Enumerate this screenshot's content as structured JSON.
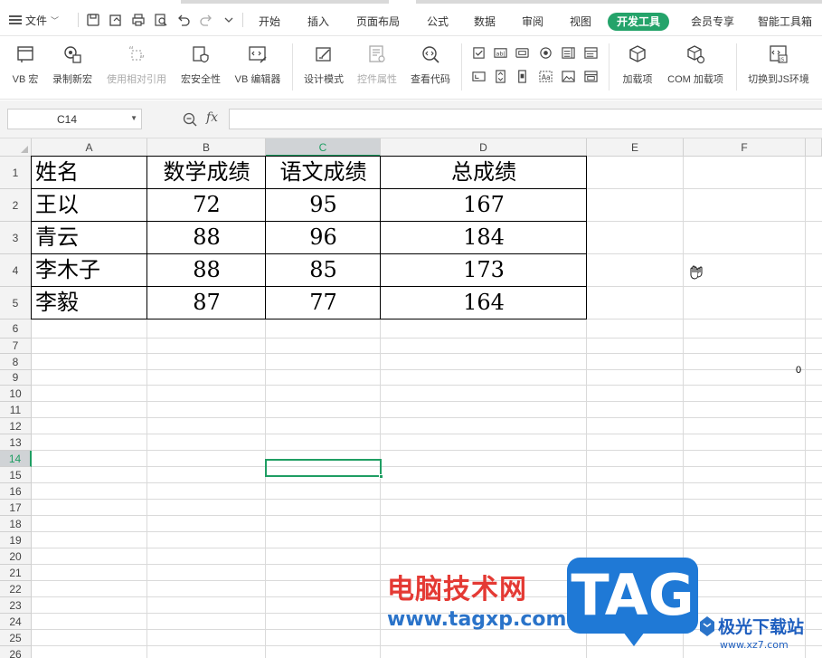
{
  "toolbar": {
    "file_label": "文件",
    "tabs": [
      {
        "label": "开始"
      },
      {
        "label": "插入"
      },
      {
        "label": "页面布局"
      },
      {
        "label": "公式"
      },
      {
        "label": "数据"
      },
      {
        "label": "审阅"
      },
      {
        "label": "视图"
      },
      {
        "label": "开发工具",
        "active": true
      },
      {
        "label": "会员专享"
      },
      {
        "label": "智能工具箱"
      }
    ]
  },
  "ribbon": {
    "buttons": [
      {
        "label": "VB 宏",
        "icon": "vb-macro-icon"
      },
      {
        "label": "录制新宏",
        "icon": "record-macro-icon"
      },
      {
        "label": "使用相对引用",
        "icon": "relative-reference-icon",
        "disabled": true
      },
      {
        "label": "宏安全性",
        "icon": "macro-security-icon"
      },
      {
        "label": "VB 编辑器",
        "icon": "vb-editor-icon"
      },
      {
        "label": "设计模式",
        "icon": "design-mode-icon"
      },
      {
        "label": "控件属性",
        "icon": "control-properties-icon",
        "disabled": true
      },
      {
        "label": "查看代码",
        "icon": "view-code-icon"
      },
      {
        "label": "加载项",
        "icon": "addins-icon"
      },
      {
        "label": "COM 加载项",
        "icon": "com-addins-icon"
      },
      {
        "label": "切换到JS环境",
        "icon": "switch-js-icon"
      }
    ],
    "small_controls": [
      "checkbox-control-icon",
      "textbox-control-icon",
      "button-control-icon",
      "radio-control-icon",
      "listbox-control-icon",
      "combobox-control-icon",
      "label-control-icon",
      "spin-control-icon",
      "scrollbar-control-icon",
      "text-label-control-icon",
      "image-control-icon",
      "frame-control-icon"
    ]
  },
  "formula_bar": {
    "name_box": "C14",
    "fx_label": "fx",
    "formula": ""
  },
  "sheet": {
    "columns": [
      "A",
      "B",
      "C",
      "D",
      "E",
      "F"
    ],
    "rows": [
      "1",
      "2",
      "3",
      "4",
      "5",
      "6",
      "7",
      "8",
      "9",
      "10",
      "11",
      "12",
      "13",
      "14",
      "15",
      "16",
      "17",
      "18",
      "19",
      "20",
      "21",
      "22",
      "23",
      "24",
      "25",
      "26"
    ],
    "selected_cell": "C14",
    "table": {
      "header": [
        "姓名",
        "数学成绩",
        "语文成绩",
        "总成绩"
      ],
      "rows": [
        [
          "王以",
          "72",
          "95",
          "167"
        ],
        [
          "青云",
          "88",
          "96",
          "184"
        ],
        [
          "李木子",
          "88",
          "85",
          "173"
        ],
        [
          "李毅",
          "87",
          "77",
          "164"
        ]
      ]
    },
    "stray_value": "0"
  },
  "watermark": {
    "site_name": "电脑技术网",
    "site_url": "www.tagxp.com",
    "tag_logo": "TAG",
    "brand_name": "极光下载站",
    "brand_url": "www.xz7.com"
  }
}
